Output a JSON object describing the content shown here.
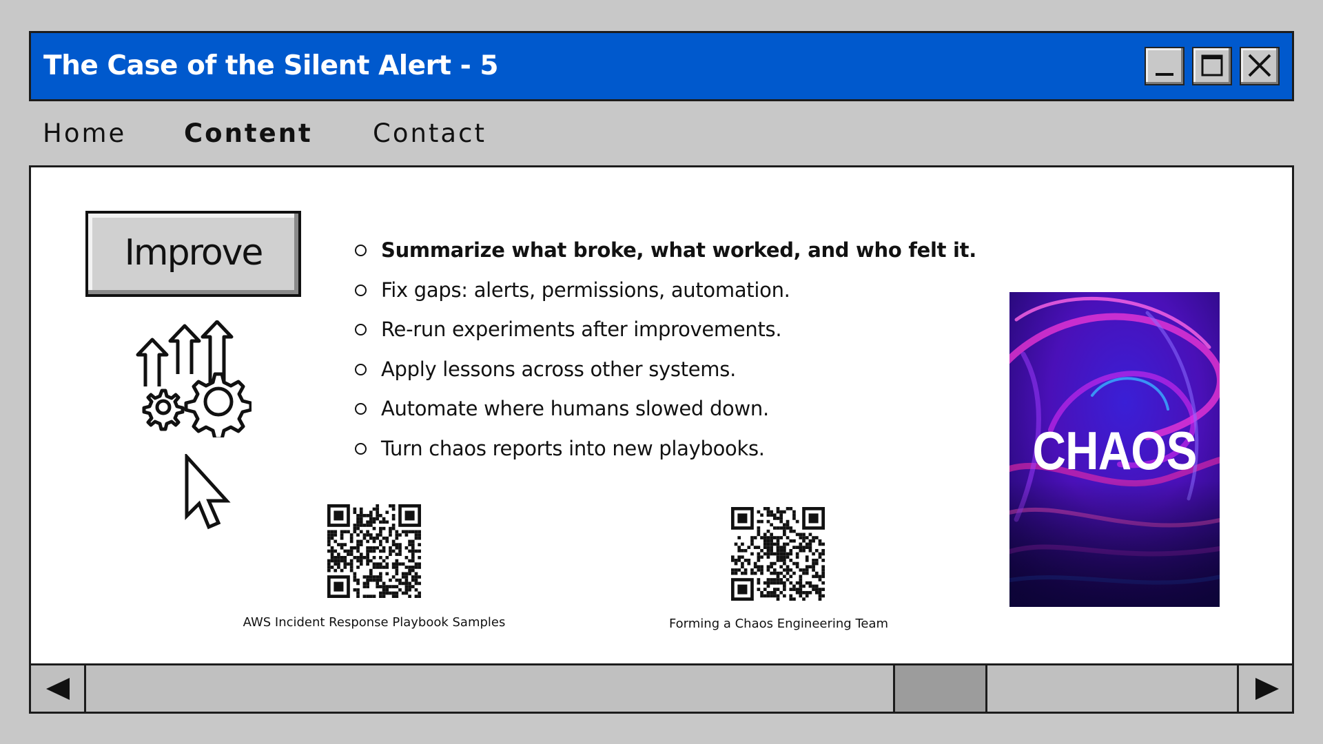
{
  "window": {
    "title": "The Case of the Silent Alert - 5",
    "title_bar_color": "#0059cd",
    "controls": [
      "minimize-icon",
      "maximize-icon",
      "close-icon"
    ]
  },
  "menu": {
    "items": [
      {
        "label": "Home",
        "active": false
      },
      {
        "label": "Content",
        "active": true
      },
      {
        "label": "Contact",
        "active": false
      }
    ]
  },
  "content": {
    "action_button": "Improve",
    "icons": [
      "improvement-gears-arrows-icon",
      "mouse-cursor-icon"
    ],
    "bullets": [
      "Summarize what broke, what worked, and who felt it.",
      "Fix gaps: alerts, permissions, automation.",
      "Re-run experiments after improvements.",
      "Apply lessons across other systems.",
      "Automate where humans slowed down.",
      "Turn chaos reports into new playbooks."
    ],
    "qr_codes": [
      {
        "caption": "AWS Incident Response Playbook Samples"
      },
      {
        "caption": "Forming a Chaos Engineering Team"
      }
    ],
    "image": {
      "text": "CHAOS"
    }
  },
  "scrollbar": {
    "left_arrow": "left-arrow-icon",
    "right_arrow": "right-arrow-icon"
  }
}
